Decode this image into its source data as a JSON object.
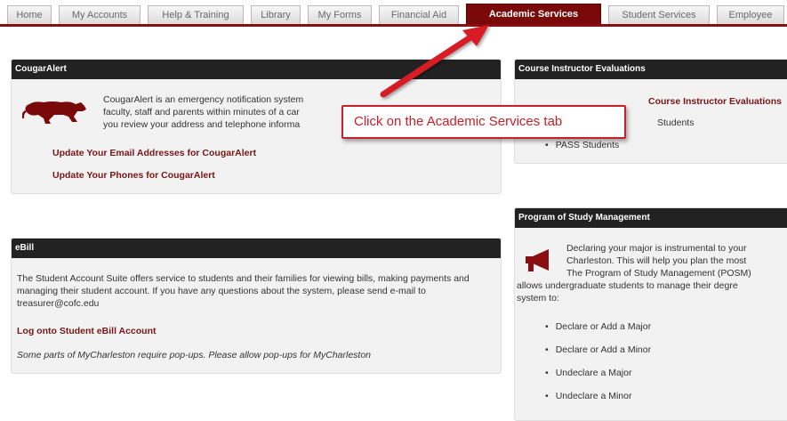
{
  "tabs": [
    {
      "label": "Home"
    },
    {
      "label": "My Accounts"
    },
    {
      "label": "Help & Training"
    },
    {
      "label": "Library"
    },
    {
      "label": "My Forms"
    },
    {
      "label": "Financial Aid"
    },
    {
      "label": "Academic Services"
    },
    {
      "label": "Student Services"
    },
    {
      "label": "Employee"
    }
  ],
  "active_tab": "Academic Services",
  "cougaralert": {
    "title": "CougarAlert",
    "line1": "CougarAlert is an emergency notification system",
    "line2": "faculty, staff and parents within minutes of a car",
    "line3": "you review your address and telephone informa",
    "link1": "Update Your Email Addresses for CougarAlert",
    "link2": "Update Your Phones for CougarAlert"
  },
  "ebill": {
    "title": "eBill",
    "text": "The Student Account Suite offers service to students and their families for viewing bills, making payments and managing their student account. If you have any questions about the system, please send e-mail to treasurer@cofc.edu",
    "link": "Log onto Student eBill Account",
    "note": "Some parts of MyCharleston require pop-ups. Please allow pop-ups for MyCharleston"
  },
  "evaluations": {
    "title": "Course Instructor Evaluations",
    "item1": "Course Instructor Evaluations",
    "item2": "Students",
    "item3": "PASS Students"
  },
  "posm": {
    "title": "Program of Study Management",
    "line1": "Declaring your major is instrumental to your",
    "line2": "Charleston. This will help you plan the most",
    "line3": "The Program of Study Management (POSM)",
    "line4": "allows undergraduate students to manage their degre",
    "line5": "system to:",
    "items": [
      "Declare or Add a Major",
      "Declare or Add a Minor",
      "Undeclare a Major",
      "Undeclare a Minor"
    ]
  },
  "callout": {
    "text": "Click on the Academic Services tab"
  },
  "colors": {
    "accent": "#7a0a0a",
    "callout": "#c7202b",
    "header": "#222222"
  }
}
